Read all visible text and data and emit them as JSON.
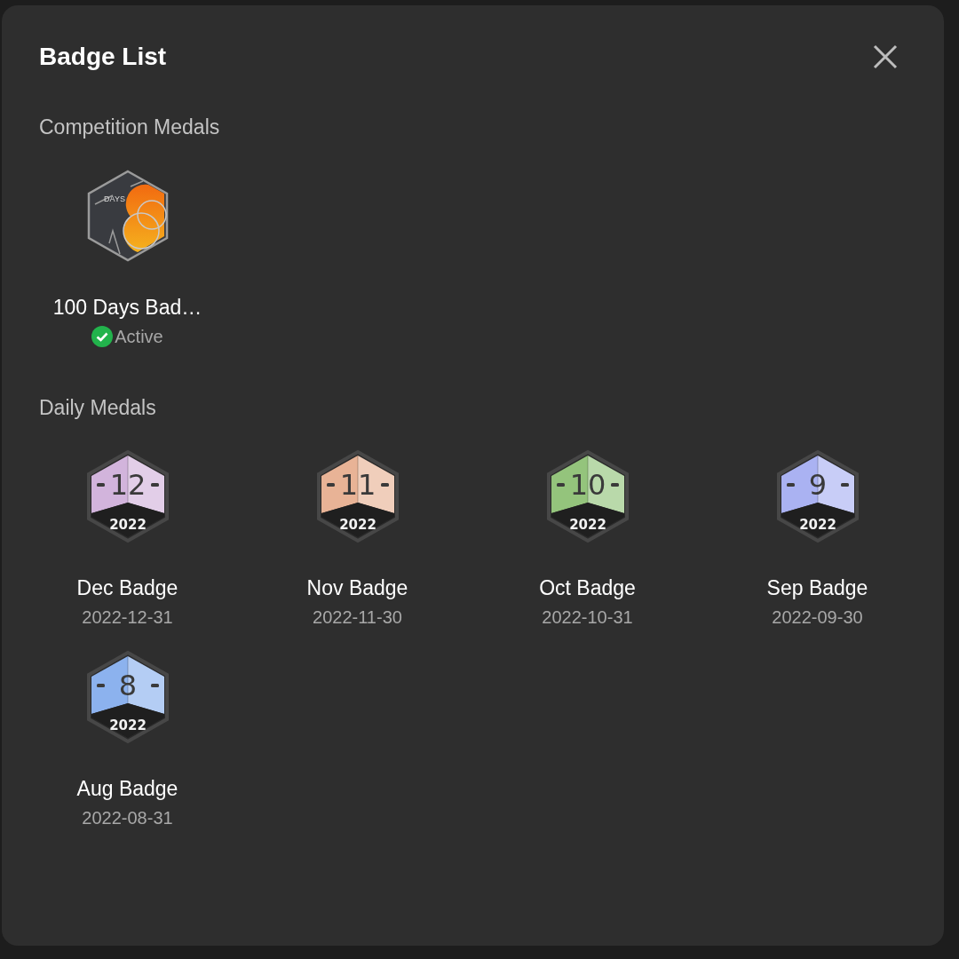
{
  "dialog": {
    "title": "Badge List"
  },
  "sections": [
    {
      "heading": "Competition Medals",
      "badges": [
        {
          "kind": "emblem",
          "art_label": "DAYS",
          "name": "100 Days Bad…",
          "status": {
            "label": "Active",
            "active": true
          }
        }
      ]
    },
    {
      "heading": "Daily Medals",
      "badges": [
        {
          "kind": "monthly",
          "number": "12",
          "year": "2022",
          "color": "#d2b4dc",
          "name": "Dec Badge",
          "date": "2022-12-31"
        },
        {
          "kind": "monthly",
          "number": "11",
          "year": "2022",
          "color": "#e8b396",
          "name": "Nov Badge",
          "date": "2022-11-30"
        },
        {
          "kind": "monthly",
          "number": "10",
          "year": "2022",
          "color": "#94c47c",
          "name": "Oct Badge",
          "date": "2022-10-31"
        },
        {
          "kind": "monthly",
          "number": "9",
          "year": "2022",
          "color": "#aab2f2",
          "name": "Sep Badge",
          "date": "2022-09-30"
        },
        {
          "kind": "monthly",
          "number": "8",
          "year": "2022",
          "color": "#8cb2ee",
          "name": "Aug Badge",
          "date": "2022-08-31"
        }
      ]
    }
  ]
}
